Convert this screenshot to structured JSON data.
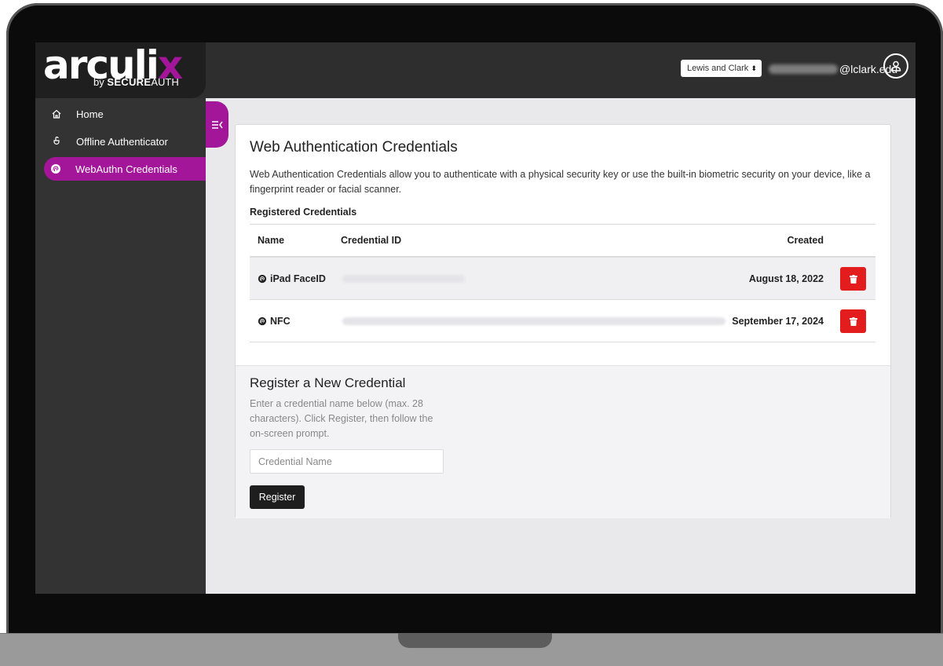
{
  "app": {
    "logo_text": "arculix",
    "logo_sub_prefix": "by ",
    "logo_sub_bold": "SECURE",
    "logo_sub_rest": "AUTH",
    "brand_color": "#a3169a"
  },
  "header": {
    "org_select_value": "Lewis and Clark",
    "user_email_domain": "@lclark.edu",
    "avatar_icon": "user-icon"
  },
  "sidebar": {
    "items": [
      {
        "label": "Home",
        "icon": "home-icon",
        "active": false
      },
      {
        "label": "Offline Authenticator",
        "icon": "offline-key-icon",
        "active": false
      },
      {
        "label": "WebAuthn Credentials",
        "icon": "fingerprint-icon",
        "active": true
      }
    ],
    "collapse_icon": "collapse-menu-icon"
  },
  "main": {
    "title": "Web Authentication Credentials",
    "description": "Web Authentication Credentials allow you to authenticate with a physical security key or use the built-in biometric security on your device, like a fingerprint reader or facial scanner.",
    "registered_heading": "Registered Credentials",
    "table": {
      "columns": [
        "Name",
        "Credential ID",
        "Created"
      ],
      "rows": [
        {
          "name": "iPad FaceID",
          "created": "August 18, 2022"
        },
        {
          "name": "NFC",
          "created": "September 17, 2024"
        }
      ],
      "delete_icon": "trash-icon",
      "delete_color": "#e31d1d"
    },
    "register": {
      "title": "Register a New Credential",
      "help": "Enter a credential name below (max. 28 characters). Click Register, then follow the on-screen prompt.",
      "input_placeholder": "Credential Name",
      "button_label": "Register"
    }
  }
}
